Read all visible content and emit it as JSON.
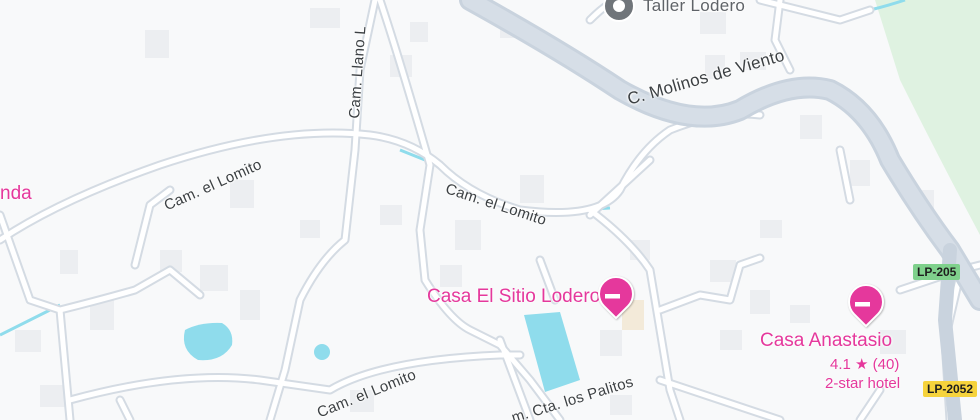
{
  "roads": {
    "molinos": "C. Molinos de Viento",
    "llano": "Cam. Llano L",
    "lomito_left": "Cam. el Lomito",
    "lomito_center": "Cam. el Lomito",
    "lomito_bottom": "Cam. el Lomito",
    "palitos": "m. Cta. los Palitos"
  },
  "pois": {
    "taller": "Taller Lodero",
    "casa_sitio": "Casa El Sitio Lodero",
    "casa_anastasio": {
      "name": "Casa Anastasio",
      "rating": "4.1",
      "star": "★",
      "reviews": "(40)",
      "category": "2-star hotel"
    },
    "partial_left": "nda"
  },
  "shields": {
    "lp205": "LP-205",
    "lp2052": "LP-2052"
  },
  "icons": {
    "hotel": "bed-icon",
    "business": "place-pin-icon"
  },
  "colors": {
    "background": "#f8f9fa",
    "road_fill": "#ffffff",
    "road_casing": "#d4dbe3",
    "highway": "#c9d3de",
    "water": "#8fdcec",
    "park": "#dff2e1",
    "building": "#eceef1",
    "poi": "#e5389c",
    "shield_green": "#7fd18c",
    "shield_yellow": "#f6d33c"
  }
}
